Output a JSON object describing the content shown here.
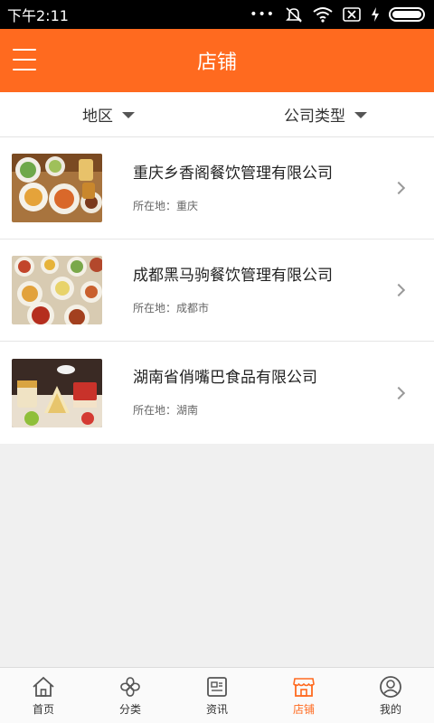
{
  "status_bar": {
    "time": "下午2:11",
    "dots": "•••"
  },
  "header": {
    "title": "店铺"
  },
  "filters": [
    {
      "label": "地区"
    },
    {
      "label": "公司类型"
    }
  ],
  "shops": [
    {
      "name": "重庆乡香阁餐饮管理有限公司",
      "location": "所在地：重庆"
    },
    {
      "name": "成都黑马驹餐饮管理有限公司",
      "location": "所在地：成都市"
    },
    {
      "name": "湖南省俏嘴巴食品有限公司",
      "location": "所在地：湖南"
    }
  ],
  "tabs": [
    {
      "label": "首页",
      "icon": "home-icon"
    },
    {
      "label": "分类",
      "icon": "category-icon"
    },
    {
      "label": "资讯",
      "icon": "news-icon"
    },
    {
      "label": "店铺",
      "icon": "shop-icon"
    },
    {
      "label": "我的",
      "icon": "profile-icon"
    }
  ],
  "colors": {
    "accent": "#ff6a1f",
    "inactive_icon": "#555555"
  },
  "active_tab": "店铺"
}
